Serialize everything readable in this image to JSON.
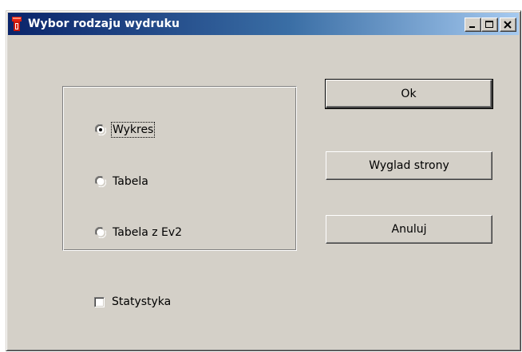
{
  "window": {
    "title": "Wybor rodzaju wydruku"
  },
  "radio_group": {
    "options": [
      {
        "label": "Wykres",
        "selected": true
      },
      {
        "label": "Tabela",
        "selected": false
      },
      {
        "label": "Tabela z Ev2",
        "selected": false
      }
    ]
  },
  "buttons": {
    "ok_label": "Ok",
    "page_view_label": "Wyglad strony",
    "cancel_label": "Anuluj"
  },
  "checkbox": {
    "label": "Statystyka",
    "checked": false
  },
  "colors": {
    "dialog_bg": "#d4d0c8",
    "title_gradient_start": "#0a246a",
    "title_gradient_end": "#a6caf0",
    "icon_red": "#e02010"
  },
  "icons": {
    "app": "flashlight-icon",
    "minimize": "minimize-icon",
    "maximize": "maximize-icon",
    "close": "close-icon"
  }
}
